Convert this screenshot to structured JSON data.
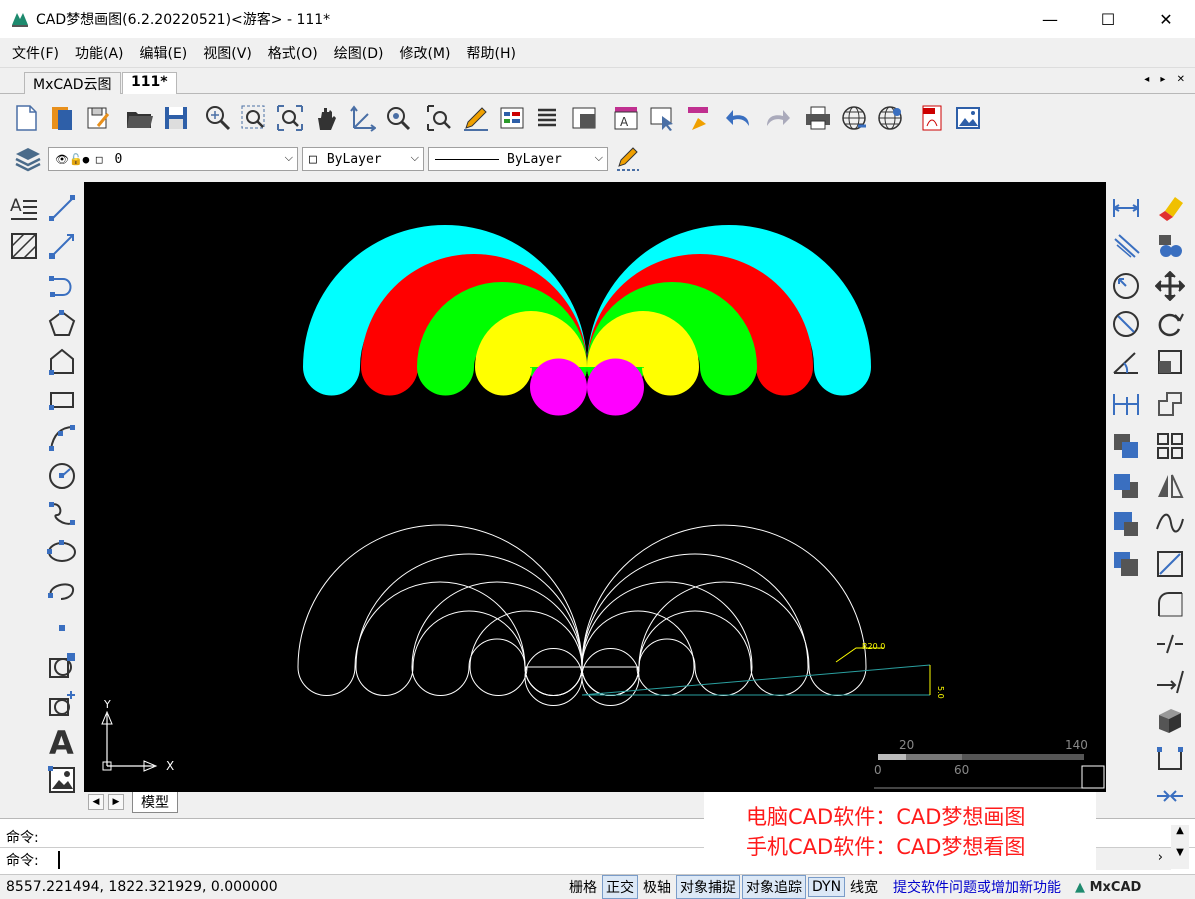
{
  "window": {
    "title": "CAD梦想画图(6.2.20220521)<游客> - 111*",
    "controls": {
      "minimize": "—",
      "maximize": "☐",
      "close": "✕"
    }
  },
  "menu": [
    "文件(F)",
    "功能(A)",
    "编辑(E)",
    "视图(V)",
    "格式(O)",
    "绘图(D)",
    "修改(M)",
    "帮助(H)"
  ],
  "tabs": [
    {
      "label": "MxCAD云图",
      "active": false
    },
    {
      "label": "111*",
      "active": true
    }
  ],
  "tab_nav": "◂ ▸ ✕",
  "layer": {
    "current": "0",
    "color_value": "ByLayer",
    "linetype_value": "ByLayer"
  },
  "drawing": {
    "dim_radius": "R20.0",
    "dim_linear": "5.0",
    "scale_ticks": [
      "20",
      "140",
      "0",
      "60"
    ],
    "ucs_y": "Y",
    "ucs_x": "X"
  },
  "fill_colors": {
    "cyan": "#00ffff",
    "red": "#ff0000",
    "green": "#00ff00",
    "yellow": "#ffff00",
    "magenta": "#ff00ff"
  },
  "layout": {
    "model_tab": "模型"
  },
  "command": {
    "line1": "命令:",
    "line2": "命令:"
  },
  "promo": {
    "line1": "电脑CAD软件：CAD梦想画图",
    "line2": "手机CAD软件：CAD梦想看图"
  },
  "status": {
    "coords": "8557.221494, 1822.321929, 0.000000",
    "toggles": [
      {
        "label": "栅格",
        "on": false
      },
      {
        "label": "正交",
        "on": true
      },
      {
        "label": "极轴",
        "on": false
      },
      {
        "label": "对象捕捉",
        "on": true
      },
      {
        "label": "对象追踪",
        "on": true
      },
      {
        "label": "DYN",
        "on": true
      },
      {
        "label": "线宽",
        "on": false
      }
    ],
    "feedback_link": "提交软件问题或增加新功能",
    "brand": "MxCAD"
  }
}
